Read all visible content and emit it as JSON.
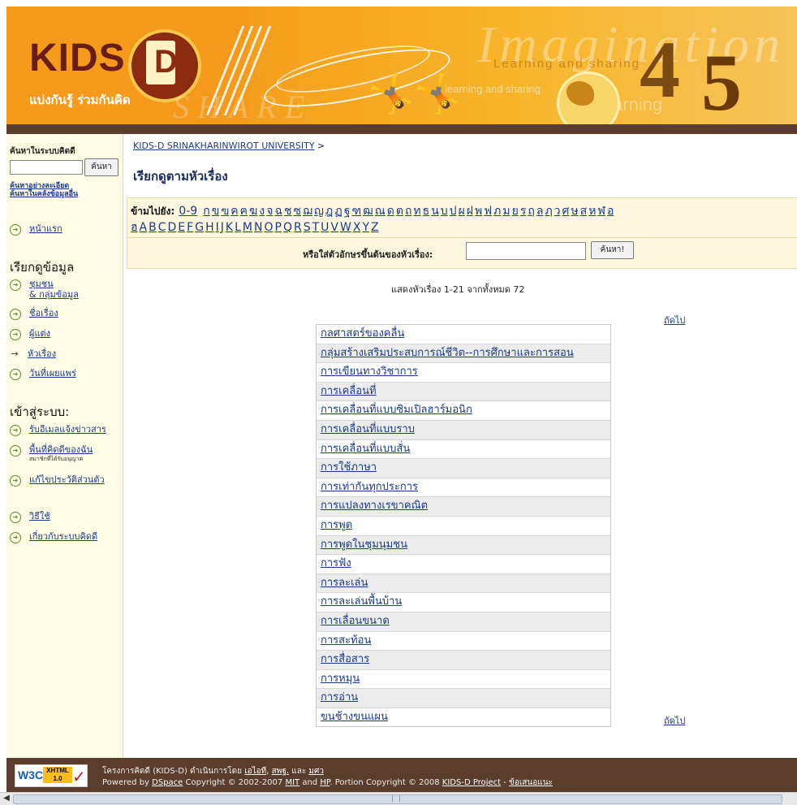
{
  "banner": {
    "logo_text": "KIDS",
    "logo_letter": "D",
    "tagline": "แบ่งกันรู้ ร่วมกันคิด",
    "bg_word": "Imagination",
    "bg_word2": "SHARE",
    "bg_text1": "Learning and sharing",
    "bg_text2": "learning and sharing",
    "bg_text3": "learning",
    "num4": "4",
    "num5": "5"
  },
  "sidebar": {
    "search_heading": "ค้นหาในระบบคิดดี",
    "search_button": "ค้นหา",
    "advanced_link": "ค้นหาอย่างละเอียด",
    "repo_link": "ค้นหาในคลังข้อมูลอื่น",
    "home": "หน้าแรก",
    "browse_heading": "เรียกดูข้อมูล",
    "communities": "ชุมชน",
    "communities2": "& กลุ่มข้อมูล",
    "titles": "ชื่อเรื่อง",
    "authors": "ผู้แต่ง",
    "subjects": "หัวเรื่อง",
    "dates": "วันที่เผยแพร่",
    "login_heading": "เข้าสู่ระบบ:",
    "email_alerts": "รับอีเมลแจ้งข่าวสาร",
    "my_space": "พื้นที่คิดดีของฉัน",
    "my_space_sub": "สมาชิกที่ได้รับอนุญาต",
    "edit_profile": "แก้ไขประวัติส่วนตัว",
    "help": "วิธีใช้",
    "about": "เกี่ยวกับระบบคิดดี"
  },
  "content": {
    "breadcrumb": "KIDS-D SRINAKHARINWIROT UNIVERSITY",
    "breadcrumb_sep": ">",
    "page_title": "เรียกดูตามหัวเรื่อง",
    "jump_label": "ข้ามไปยัง:",
    "jump_09": "0-9",
    "thai_letters": [
      "ก",
      "ข",
      "ฃ",
      "ค",
      "ฅ",
      "ฆ",
      "ง",
      "จ",
      "ฉ",
      "ช",
      "ซ",
      "ฌ",
      "ญ",
      "ฎ",
      "ฏ",
      "ฐ",
      "ฑ",
      "ฒ",
      "ณ",
      "ด",
      "ต",
      "ถ",
      "ท",
      "ธ",
      "น",
      "บ",
      "ป",
      "ผ",
      "ฝ",
      "พ",
      "ฟ",
      "ภ",
      "ม",
      "ย",
      "ร",
      "ฤ",
      "ล",
      "ฦ",
      "ว",
      "ศ",
      "ษ",
      "ส",
      "ห",
      "ฬ",
      "อ"
    ],
    "latin_letters": [
      "ฮ",
      "A",
      "B",
      "C",
      "D",
      "E",
      "F",
      "G",
      "H",
      "I",
      "J",
      "K",
      "L",
      "M",
      "N",
      "O",
      "P",
      "Q",
      "R",
      "S",
      "T",
      "U",
      "V",
      "W",
      "X",
      "Y",
      "Z"
    ],
    "start_label": "หรือใส่ตัวอักษรขึ้นต้นของหัวเรื่อง:",
    "start_button": "ค้นหา!",
    "showing": "แสดงหัวเรื่อง 1-21 จากทั้งหมด 72",
    "next": "ถัดไป",
    "subjects": [
      "กลศาสตร์ของคลื่น",
      "กลุ่มสร้างเสริมประสบการณ์ชีวิต--การศึกษาและการสอน",
      "การเขียนทางวิชาการ",
      "การเคลื่อนที่",
      "การเคลื่อนที่แบบซิมเปิลฮาร์มอนิก",
      "การเคลื่อนที่แบบราบ",
      "การเคลื่อนที่แบบสั่น",
      "การใช้ภาษา",
      "การเท่ากันทุกประการ",
      "การแปลงทางเรขาคณิต",
      "การพูด",
      "การพูดในชุมนุมชน",
      "การฟัง",
      "การละเล่น",
      "การละเล่นพื้นบ้าน",
      "การเลื่อนขนาด",
      "การสะท้อน",
      "การสื่อสาร",
      "การหมุน",
      "การอ่าน",
      "ขนช้างขนแผน"
    ]
  },
  "footer": {
    "badge_w3c": "W3C",
    "badge_xhtml": "XHTML",
    "badge_version": "1.0",
    "line1_prefix": "โครงการคิดดี (KIDS-D) ดำเนินการโดย",
    "link_ict": "เอไอที",
    "sep1": ",",
    "link_swu": "สพฐ.",
    "and": "และ",
    "link_ntc": "มศว",
    "line2_powered": "Powered by",
    "link_dspace": "DSpace",
    "copy1": "Copyright © 2002-2007",
    "link_mit": "MIT",
    "and_en": "and",
    "link_hp": "HP",
    "copy2": ". Portion Copyright © 2008",
    "link_project": "KIDS-D Project",
    "dash": "-",
    "link_feedback": "ข้อเสนอแนะ"
  },
  "colors": {
    "banner_orange": "#f08a18",
    "dark_brown": "#5a3d2c",
    "sidebar_bg": "#fffce5",
    "link": "#1a3a8a",
    "bullet_green": "#5f8f2a"
  }
}
